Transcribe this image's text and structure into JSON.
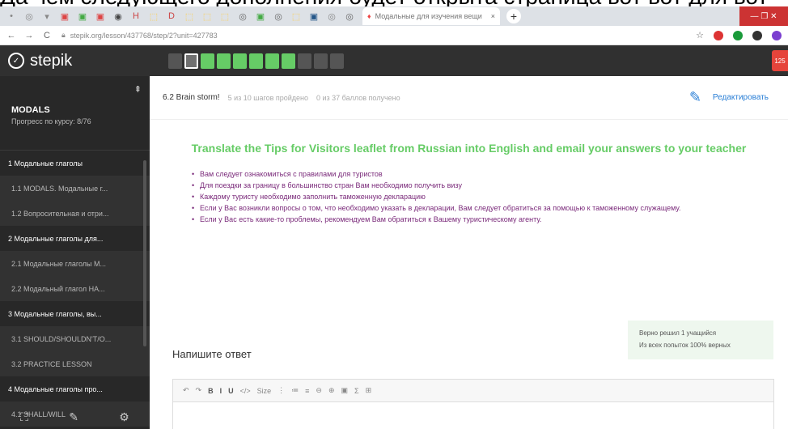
{
  "caption": "Да чем следующего дополнения будет открыта страница вот вот для вот",
  "browser": {
    "tab_icons": [
      "•",
      "◎",
      "▾",
      "▣",
      "▣",
      "▣",
      "◉",
      "H",
      "⬚",
      "D",
      "⬚",
      "⬚",
      "⬚",
      "◎",
      "▣",
      "◎",
      "⬚",
      "▣",
      "◎",
      "◎"
    ],
    "tab_icon_colors": [
      "#888",
      "#888",
      "#888",
      "#d44",
      "#4a4",
      "#d44",
      "#444",
      "#c44",
      "#fc4",
      "#c44",
      "#fc4",
      "#fc4",
      "#fc4",
      "#666",
      "#4a4",
      "#666",
      "#fc4",
      "#258",
      "#888",
      "#666"
    ],
    "active_tab_title": "Модальные для изучения вещи",
    "active_tab_close": "×",
    "new_tab": "+",
    "window_controls": "— ❐ ✕",
    "nav_back": "←",
    "nav_forward": "→",
    "reload": "C",
    "url": "stepik.org/lesson/437768/step/2?unit=427783",
    "star": "☆",
    "ext_colors": [
      "#d33",
      "#1a9a3a",
      "#333",
      "#7b3fd0"
    ]
  },
  "header": {
    "logo_text": "stepik",
    "steps": [
      "pending",
      "current",
      "done",
      "done",
      "done",
      "done",
      "done",
      "done",
      "pending",
      "pending",
      "pending"
    ],
    "badge_label": "125"
  },
  "sidebar": {
    "title": "MODALS",
    "progress": "Прогресс по курсу: 8/76",
    "pin": "⇞",
    "items": [
      {
        "type": "module",
        "label": "1 Модальные глаголы"
      },
      {
        "type": "lesson",
        "label": "1.1 MODALS. Модальные г..."
      },
      {
        "type": "lesson",
        "label": "1.2 Вопросительная и отри..."
      },
      {
        "type": "module",
        "label": "2 Модальные глаголы для..."
      },
      {
        "type": "lesson",
        "label": "2.1 Модальные глаголы М..."
      },
      {
        "type": "lesson",
        "label": "2.2 Модальный глагол НА..."
      },
      {
        "type": "module",
        "label": "3 Модальные глаголы, вы..."
      },
      {
        "type": "lesson",
        "label": "3.1 SHOULD/SHOULDN'T/O..."
      },
      {
        "type": "lesson",
        "label": "3.2 PRACTICE LESSON"
      },
      {
        "type": "module",
        "label": "4 Модальные глаголы про..."
      },
      {
        "type": "lesson",
        "label": "4.1 SHALL/WILL"
      }
    ],
    "bottom_icons": [
      "⛶",
      "✎",
      "⚙"
    ]
  },
  "main": {
    "step_name": "6.2 Brain storm!",
    "passed": "5 из 10 шагов пройдено",
    "points": "0 из 37 баллов получено",
    "edit_label": "Редактировать",
    "task_title": "Translate the Tips for Visitors leaflet from Russian into English and email your answers to your teacher",
    "bullets": [
      "Вам следует ознакомиться с правилами для туристов",
      "Для поездки за границу в большинство стран Вам необходимо получить визу",
      "Каждому туристу необходимо заполнить таможенную декларацию",
      "Если у Вас возникли вопросы о том, что необходимо указать в декларации, Вам следует обратиться за помощью к таможенному служащему.",
      "Если у Вас есть какие-то проблемы, рекомендуем Вам обратиться к Вашему туристическому агенту."
    ],
    "stats_line1": "Верно решил 1 учащийся",
    "stats_line2": "Из всех попыток 100% верных",
    "answer_label": "Напишите ответ",
    "toolbar": [
      "↶",
      "↷",
      "B",
      "I",
      "U",
      "</>",
      "Size",
      "⋮",
      "≔",
      "≡",
      "⊖",
      "⊕",
      "▣",
      "Σ",
      "⊞"
    ]
  }
}
